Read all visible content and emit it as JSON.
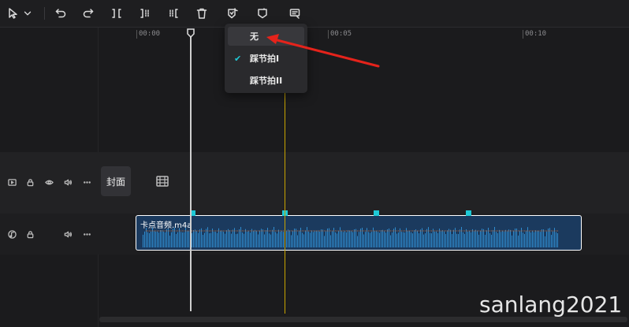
{
  "toolbar": {
    "icons": [
      "select-pointer-icon",
      "dropdown-chevron-icon",
      "undo-icon",
      "redo-icon",
      "split-icon",
      "trim-left-icon",
      "trim-right-icon",
      "delete-icon",
      "auto-beat-icon",
      "beat-marker-icon",
      "caption-icon"
    ]
  },
  "ruler": {
    "ticks": [
      "00:00",
      "00:05",
      "00:10"
    ]
  },
  "dropdown": {
    "items": [
      {
        "label": "无",
        "checked": false,
        "highlighted": true
      },
      {
        "label": "踩节拍I",
        "checked": true,
        "highlighted": false
      },
      {
        "label": "踩节拍II",
        "checked": false,
        "highlighted": false
      }
    ]
  },
  "video_track": {
    "cover_label": "封面"
  },
  "audio_track": {
    "clip_name": "卡点音频.m4a",
    "beat_marker_count": 4
  },
  "colors": {
    "accent": "#1fc9d6",
    "clip_bg": "#1b3a5e",
    "playhead": "#cfcfcf",
    "beat_line": "#c9a400",
    "annotation_arrow": "#e5231b"
  },
  "watermark": "sanlang2021"
}
